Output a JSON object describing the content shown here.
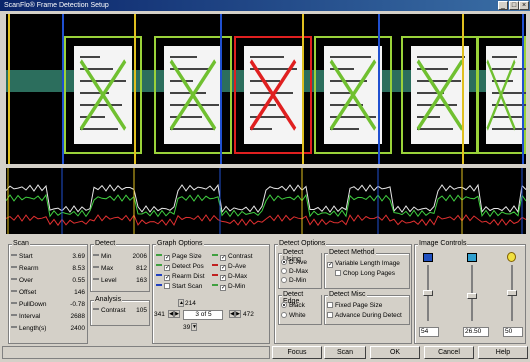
{
  "window": {
    "title": "ScanFlo® Frame Detection Setup"
  },
  "scan": {
    "title": "Scan",
    "rows": [
      {
        "label": "Start",
        "value": "3.69"
      },
      {
        "label": "Rearm",
        "value": "8.53"
      },
      {
        "label": "Over",
        "value": "0.55"
      },
      {
        "label": "Offset",
        "value": "146"
      },
      {
        "label": "PullDown",
        "value": "-0.78"
      },
      {
        "label": "Interval",
        "value": "2688"
      },
      {
        "label": "Length(s)",
        "value": "2400"
      }
    ]
  },
  "detect": {
    "title": "Detect",
    "rows": [
      {
        "label": "Min",
        "value": "2006"
      },
      {
        "label": "Max",
        "value": "812"
      },
      {
        "label": "Level",
        "value": "163"
      }
    ]
  },
  "analysis": {
    "title": "Analysis",
    "label": "Contrast",
    "value": "105"
  },
  "graph_options": {
    "title": "Graph Options",
    "items": [
      {
        "label": "Page Size",
        "checked": true,
        "color": "#40a040"
      },
      {
        "label": "Detect Pos",
        "checked": true,
        "color": "#40a040"
      },
      {
        "label": "Rearm Dist",
        "checked": true,
        "color": "#2040c0"
      },
      {
        "label": "Start Scan",
        "checked": false,
        "color": "#2040c0"
      },
      {
        "label": "Contrast",
        "checked": true,
        "color": "#40a040"
      },
      {
        "label": "D-Ave",
        "checked": true,
        "color": "#c02020"
      },
      {
        "label": "D-Max",
        "checked": true,
        "color": "#c02020"
      },
      {
        "label": "D-Min",
        "checked": true,
        "color": "#40a040"
      }
    ],
    "nav": {
      "top": "214",
      "left": "341",
      "page": "3 of 5",
      "right": "472",
      "bottom": "39"
    }
  },
  "detect_options": {
    "title": "Detect Options",
    "using_title": "Detect Using",
    "using": [
      {
        "label": "D-Ave",
        "selected": true
      },
      {
        "label": "D-Max",
        "selected": false
      },
      {
        "label": "D-Min",
        "selected": false
      }
    ],
    "method_title": "Detect Method",
    "method": [
      {
        "label": "Variable Length Image",
        "checked": true
      },
      {
        "label": "Chop Long Pages",
        "checked": false
      }
    ],
    "edge_title": "Detect Edge",
    "edge": [
      {
        "label": "Black",
        "selected": true
      },
      {
        "label": "White",
        "selected": false
      }
    ],
    "misc_title": "Detect Misc",
    "misc": [
      {
        "label": "Fixed Page Size",
        "checked": false
      },
      {
        "label": "Advance During Detect",
        "checked": false
      }
    ]
  },
  "image_controls": {
    "title": "Image Controls",
    "values": [
      "54",
      "26.50",
      "50"
    ],
    "levels": [
      0.5,
      0.45,
      0.5
    ]
  },
  "buttons": {
    "focus": "Focus",
    "scan": "Scan",
    "ok": "OK",
    "cancel": "Cancel",
    "help": "Help"
  }
}
